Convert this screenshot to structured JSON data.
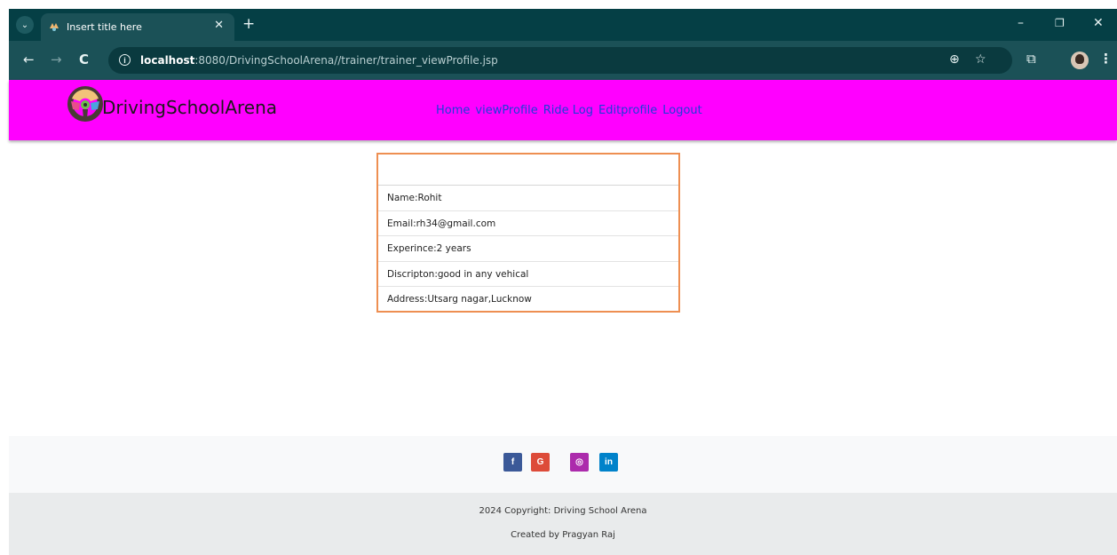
{
  "browser": {
    "tab_title": "Insert title here",
    "url_host": "localhost",
    "url_rest": ":8080/DrivingSchoolArena//trainer/trainer_viewProfile.jsp"
  },
  "site": {
    "brand": "DrivingSchoolArena",
    "nav": [
      "Home",
      "viewProfile",
      "Ride Log",
      "Editprofile",
      "Logout"
    ],
    "header_color": "#ff00ff",
    "link_color": "#1c3fd8"
  },
  "profile": {
    "name": "Name:Rohit",
    "email": "Email:rh34@gmail.com",
    "experience": "Experince:2 years",
    "description": "Discripton:good in any vehical",
    "address": "Address:Utsarg nagar,Lucknow",
    "border_color": "#ee8f52"
  },
  "footer": {
    "social": [
      {
        "icon": "facebook-icon",
        "glyph": "f",
        "color": "#3b5998"
      },
      {
        "icon": "google-icon",
        "glyph": "G",
        "color": "#dd4b39"
      },
      {
        "icon": "instagram-icon",
        "glyph": "◎",
        "color": "#ac2bac"
      },
      {
        "icon": "linkedin-icon",
        "glyph": "in",
        "color": "#0082ca"
      }
    ],
    "copyright": "2024 Copyright: Driving School Arena",
    "credit": "Created by Pragyan Raj"
  }
}
